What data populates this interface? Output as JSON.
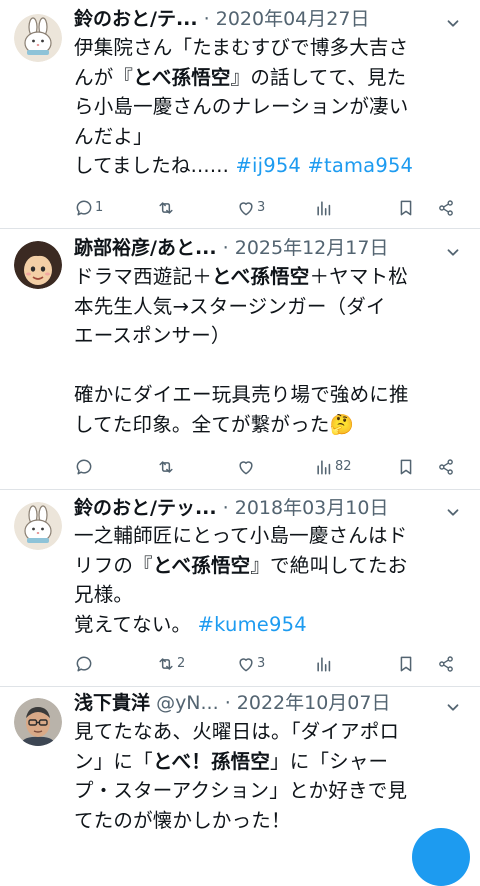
{
  "tweets": [
    {
      "name": "鈴のおと/テ...",
      "handle": "",
      "date": "2020年04月27日",
      "lines": [
        [
          {
            "t": "伊集院さん「たまむすびで博多大吉さ"
          }
        ],
        [
          {
            "t": "んが『"
          },
          {
            "t": "とべ孫悟空",
            "b": true
          },
          {
            "t": "』の話してて、見た"
          }
        ],
        [
          {
            "t": "ら小島一慶さんのナレーションが凄い"
          }
        ],
        [
          {
            "t": "んだよ」"
          }
        ],
        [
          {
            "t": "してましたね...... "
          },
          {
            "t": "#ij954",
            "tag": true
          },
          {
            "t": " "
          },
          {
            "t": "#tama954",
            "tag": true
          }
        ]
      ],
      "reply_count": "1",
      "retweet_count": "",
      "like_count": "3",
      "view_count": ""
    },
    {
      "name": "跡部裕彦/あと...",
      "handle": "",
      "date": "2025年12月17日",
      "lines": [
        [
          {
            "t": "ドラマ西遊記＋"
          },
          {
            "t": "とべ孫悟空",
            "b": true
          },
          {
            "t": "＋ヤマト松"
          }
        ],
        [
          {
            "t": "本先生人気→スタージンガー（ダイ"
          }
        ],
        [
          {
            "t": "エースポンサー）"
          }
        ],
        [],
        [
          {
            "t": "確かにダイエー玩具売り場で強めに推"
          }
        ],
        [
          {
            "t": "してた印象。全てが繋がった🤔"
          }
        ]
      ],
      "reply_count": "",
      "retweet_count": "",
      "like_count": "",
      "view_count": "82"
    },
    {
      "name": "鈴のおと/テッ...",
      "handle": "",
      "date": "2018年03月10日",
      "lines": [
        [
          {
            "t": "一之輔師匠にとって小島一慶さんはド"
          }
        ],
        [
          {
            "t": "リフの『"
          },
          {
            "t": "とべ孫悟空",
            "b": true
          },
          {
            "t": "』で絶叫してたお"
          }
        ],
        [
          {
            "t": "兄様。"
          }
        ],
        [
          {
            "t": "覚えてない。 "
          },
          {
            "t": "#kume954",
            "tag": true
          }
        ]
      ],
      "reply_count": "",
      "retweet_count": "2",
      "like_count": "3",
      "view_count": ""
    },
    {
      "name": "浅下貴洋",
      "handle": "@yN...",
      "date": "2022年10月07日",
      "lines": [
        [
          {
            "t": "見てたなあ、火曜日は。「ダイアポロ"
          }
        ],
        [
          {
            "t": "ン」に「"
          },
          {
            "t": "とべ！孫悟空",
            "b": true
          },
          {
            "t": "」に「シャー"
          }
        ],
        [
          {
            "t": "プ・スターアクション」とか好きで見"
          }
        ],
        [
          {
            "t": "てたのが懐かしかった！"
          }
        ]
      ],
      "reply_count": "",
      "retweet_count": "",
      "like_count": "",
      "view_count": ""
    }
  ],
  "separator": "·",
  "colors": {
    "text": "#0f1419",
    "muted": "#536471",
    "accent": "#1d9bf0",
    "divider": "#dfe3e7"
  },
  "icons": [
    "reply-icon",
    "retweet-icon",
    "like-icon",
    "views-icon",
    "bookmark-icon",
    "share-icon",
    "more-icon"
  ]
}
